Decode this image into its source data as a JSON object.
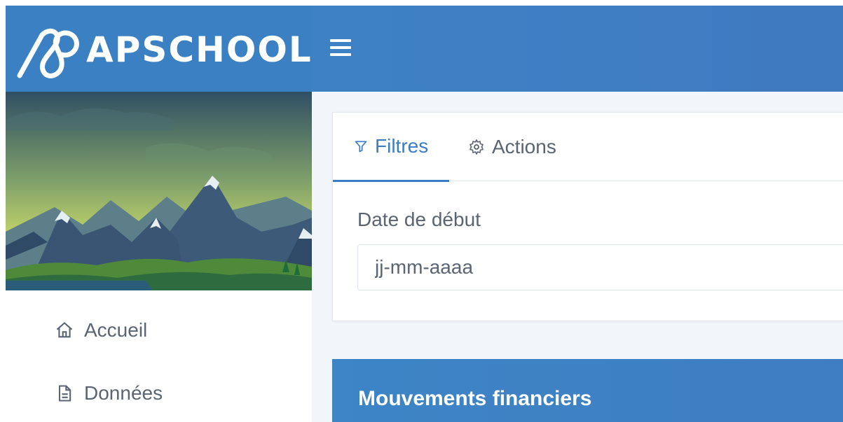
{
  "header": {
    "brand_name": "APSCHOOL"
  },
  "sidebar": {
    "items": [
      {
        "label": "Accueil",
        "icon": "home-icon"
      },
      {
        "label": "Données",
        "icon": "document-icon"
      }
    ]
  },
  "filters_card": {
    "tabs": [
      {
        "label": "Filtres",
        "icon": "filter-icon",
        "active": true
      },
      {
        "label": "Actions",
        "icon": "gear-icon",
        "active": false
      }
    ],
    "start_date": {
      "label": "Date de début",
      "placeholder": "jj-mm-aaaa",
      "value": ""
    }
  },
  "panel": {
    "title": "Mouvements financiers"
  },
  "colors": {
    "primary": "#3d85c6",
    "text": "#5a6472",
    "active_tab": "#3b7cc4"
  }
}
